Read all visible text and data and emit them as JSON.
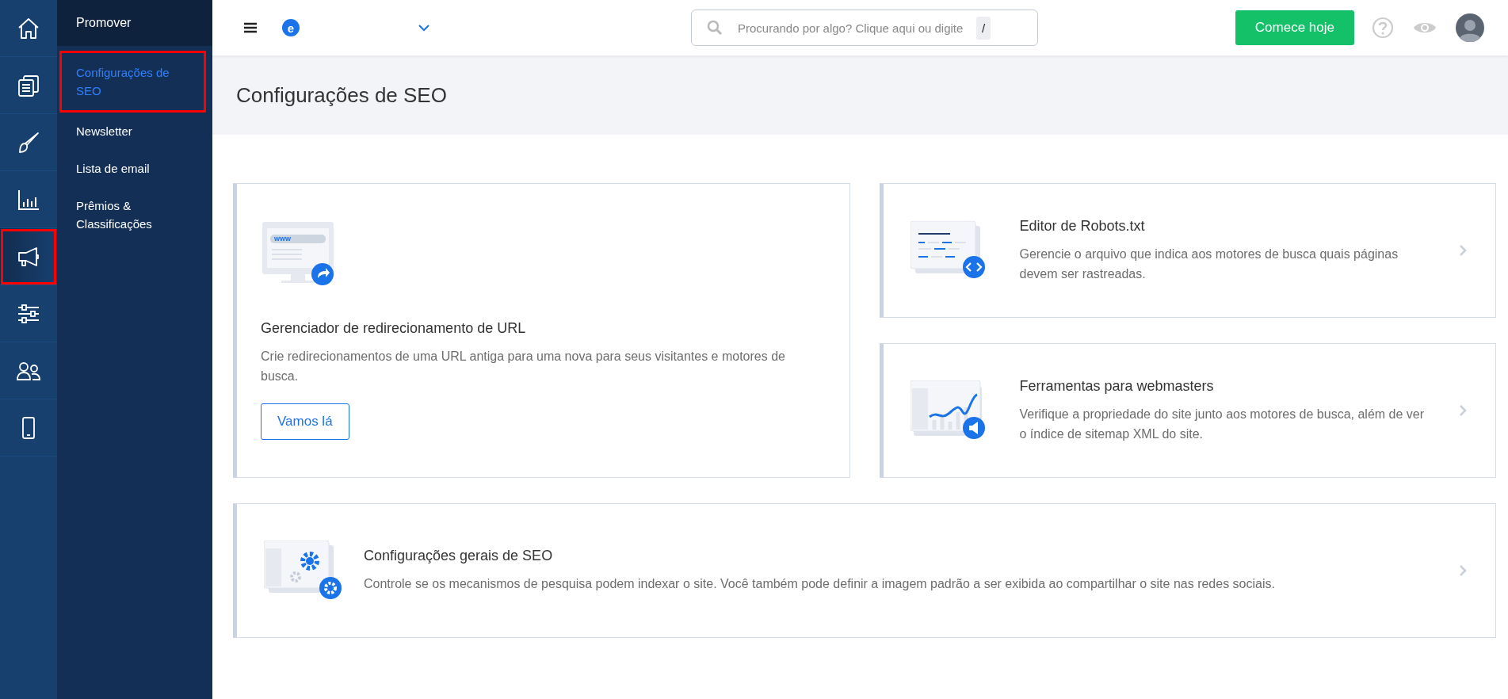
{
  "rail": [
    {
      "selected": false,
      "highlighted": false
    },
    {
      "selected": false,
      "highlighted": false
    },
    {
      "selected": false,
      "highlighted": false
    },
    {
      "selected": false,
      "highlighted": false
    },
    {
      "selected": true,
      "highlighted": true
    },
    {
      "selected": false,
      "highlighted": false
    },
    {
      "selected": false,
      "highlighted": false
    },
    {
      "selected": false,
      "highlighted": false
    }
  ],
  "nav": {
    "title": "Promover",
    "items": [
      {
        "label": "Configurações de SEO",
        "selected": true,
        "highlighted": true
      },
      {
        "label": "Newsletter",
        "selected": false,
        "highlighted": false
      },
      {
        "label": "Lista de email",
        "selected": false,
        "highlighted": false
      },
      {
        "label": "Prêmios & Classificações",
        "selected": false,
        "highlighted": false
      }
    ]
  },
  "topbar": {
    "logo_letter": "e",
    "search": {
      "placeholder": "Procurando por algo? Clique aqui ou digite",
      "shortcut": "/"
    },
    "cta": "Comece hoje"
  },
  "page_title": "Configurações de SEO",
  "cards": [
    {
      "kind": "feature",
      "screen_text": "www",
      "title": "Gerenciador de redirecionamento de URL",
      "description": "Crie redirecionamentos de uma URL antiga para uma nova para seus visitantes e motores de busca.",
      "button": "Vamos lá"
    },
    {
      "kind": "link",
      "title": "Editor de Robots.txt",
      "description": "Gerencie o arquivo que indica aos motores de busca quais páginas devem ser rastreadas."
    },
    {
      "kind": "link",
      "title": "Ferramentas para webmasters",
      "description": "Verifique a propriedade do site junto aos motores de busca, além de ver o índice de sitemap XML do site."
    },
    {
      "kind": "wide",
      "title": "Configurações gerais de SEO",
      "description": "Controle se os mecanismos de pesquisa podem indexar o site. Você também pode definir a imagem padrão a ser exibida ao compartilhar o site nas redes sociais."
    }
  ]
}
